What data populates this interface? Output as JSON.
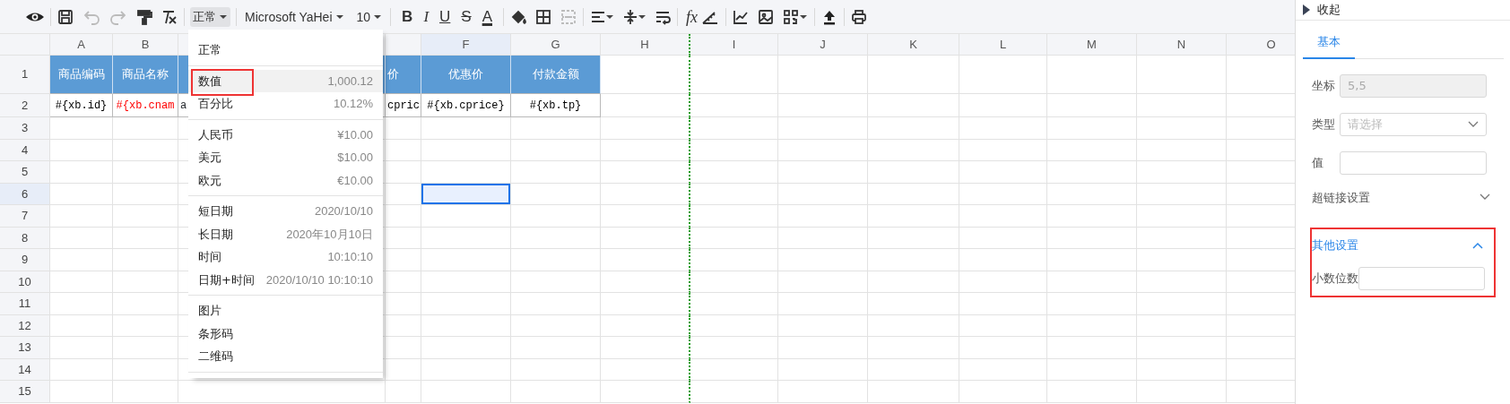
{
  "toolbar": {
    "undo": {
      "disabled": true
    },
    "redo": {
      "disabled": true
    },
    "format_select": {
      "label": "正常",
      "expanded": true
    },
    "font_select": "Microsoft YaHei",
    "size_select": "10",
    "text_style_buttons": [
      "B",
      "I",
      "U",
      "S",
      "A"
    ],
    "merge": {
      "disabled": true
    },
    "function_button": "fx"
  },
  "format_menu": {
    "groups": [
      [
        {
          "label": "正常",
          "selected": false,
          "marked": false
        }
      ],
      [
        {
          "label": "数值",
          "example": "1,000.12",
          "selected": true,
          "marked": true
        },
        {
          "label": "百分比",
          "example": "10.12%",
          "selected": false,
          "marked": false
        }
      ],
      [
        {
          "label": "人民币",
          "example": "¥10.00",
          "selected": false,
          "marked": false
        },
        {
          "label": "美元",
          "example": "$10.00",
          "selected": false,
          "marked": false
        },
        {
          "label": "欧元",
          "example": "€10.00",
          "selected": false,
          "marked": false
        }
      ],
      [
        {
          "label": "短日期",
          "example": "2020/10/10",
          "selected": false,
          "marked": false
        },
        {
          "label": "长日期",
          "example": "2020年10月10日",
          "selected": false,
          "marked": false
        },
        {
          "label": "时间",
          "example": "10:10:10",
          "selected": false,
          "marked": false
        },
        {
          "label": "日期+时间",
          "example": "2020/10/10 10:10:10",
          "selected": false,
          "marked": false
        }
      ],
      [
        {
          "label": "图片",
          "selected": false,
          "marked": false
        },
        {
          "label": "条形码",
          "selected": false,
          "marked": false
        },
        {
          "label": "二维码",
          "selected": false,
          "marked": false
        }
      ]
    ]
  },
  "sheet": {
    "columns": [
      {
        "label": "A",
        "selected": false,
        "page_break": false
      },
      {
        "label": "B",
        "selected": false,
        "page_break": false
      },
      {
        "selected": false,
        "page_break": false
      },
      {
        "selected": false,
        "page_break": false
      },
      {
        "label": "F",
        "selected": true,
        "page_break": false
      },
      {
        "label": "G",
        "selected": false,
        "page_break": false
      },
      {
        "label": "H",
        "selected": false,
        "page_break": true
      },
      {
        "label": "I",
        "selected": false,
        "page_break": false
      },
      {
        "label": "J",
        "selected": false,
        "page_break": false
      },
      {
        "label": "K",
        "selected": false,
        "page_break": false
      },
      {
        "label": "L",
        "selected": false,
        "page_break": false
      },
      {
        "label": "M",
        "selected": false,
        "page_break": false
      },
      {
        "label": "N",
        "selected": false,
        "page_break": false
      },
      {
        "label": "O",
        "selected": false,
        "page_break": false
      }
    ],
    "rows": [
      {
        "label": "1",
        "selected": false,
        "cells": [
          {
            "kind": "header",
            "text": "商品编码"
          },
          {
            "kind": "header",
            "text": "商品名称"
          },
          {
            "kind": "header"
          },
          {
            "kind": "header",
            "text": "价"
          },
          {
            "kind": "header",
            "text": "优惠价"
          },
          {
            "kind": "header",
            "text": "付款金额"
          }
        ]
      },
      {
        "label": "2",
        "selected": false,
        "cells": [
          {
            "kind": "field",
            "text": "#{xb.id}",
            "color": "#000000"
          },
          {
            "kind": "field",
            "text": "#{xb.cnam",
            "color": "#ff0000"
          },
          {
            "kind": "field",
            "text": "a"
          },
          {
            "kind": "field",
            "text": "cpric",
            "color": "#000000"
          },
          {
            "kind": "field",
            "text": "#{xb.cprice}",
            "color": "#000000"
          },
          {
            "kind": "field",
            "text": "#{xb.tp}",
            "color": "#000000"
          }
        ]
      },
      {
        "label": "3",
        "selected": false
      },
      {
        "label": "4",
        "selected": false
      },
      {
        "label": "5",
        "selected": false
      },
      {
        "label": "6",
        "selected": true
      },
      {
        "label": "7",
        "selected": false
      },
      {
        "label": "8",
        "selected": false
      },
      {
        "label": "9",
        "selected": false
      },
      {
        "label": "10",
        "selected": false
      },
      {
        "label": "11",
        "selected": false
      },
      {
        "label": "12",
        "selected": false
      },
      {
        "label": "13",
        "selected": false
      },
      {
        "label": "14",
        "selected": false
      },
      {
        "label": "15",
        "selected": false
      }
    ]
  },
  "panel": {
    "collapse_label": "收起",
    "tabs": [
      {
        "label": "基本",
        "selected": true
      }
    ],
    "fields": [
      {
        "label": "坐标",
        "kind": "input",
        "value": "5,5",
        "disabled": true
      },
      {
        "label": "类型",
        "kind": "select",
        "placeholder": "请选择",
        "disabled": false
      },
      {
        "label": "值",
        "kind": "input",
        "disabled": false
      }
    ],
    "sections": [
      {
        "title": "超链接设置",
        "expanded": false,
        "marked": false
      },
      {
        "title": "其他设置",
        "expanded": true,
        "marked": true,
        "fields": [
          {
            "label": "小数位数",
            "kind": "input",
            "disabled": false
          }
        ]
      }
    ]
  }
}
